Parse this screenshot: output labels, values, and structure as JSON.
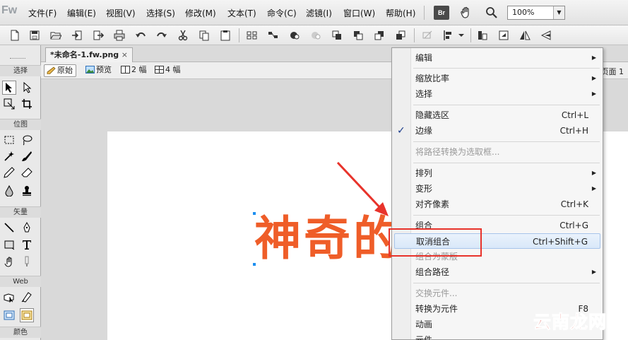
{
  "app": {
    "logo": "Fw"
  },
  "menubar": {
    "items": [
      "文件(F)",
      "编辑(E)",
      "视图(V)",
      "选择(S)",
      "修改(M)",
      "文本(T)",
      "命令(C)",
      "滤镜(I)",
      "窗口(W)",
      "帮助(H)"
    ],
    "bridge_button": "Br",
    "hand_icon": "hand-icon",
    "zoom_icon": "magnifier-icon",
    "zoom_value": "100%"
  },
  "toolbar": {
    "icons": [
      "new-file-icon",
      "save-icon",
      "open-icon",
      "import-icon",
      "export-icon",
      "print-icon",
      "undo-icon",
      "redo-icon",
      "cut-icon",
      "copy-icon",
      "paste-icon",
      "group-icon",
      "ungroup-icon",
      "join-icon",
      "split-icon",
      "bring-front-icon",
      "bring-forward-icon",
      "send-backward-icon",
      "send-back-icon",
      "align-icon",
      "distribute-icon",
      "rotate-icon",
      "flip-horizontal-icon",
      "flip-vertical-icon",
      "flip-icon"
    ]
  },
  "tools": {
    "sections": [
      "选择",
      "位图",
      "矢量",
      "Web",
      "颜色"
    ]
  },
  "document": {
    "tab_title": "*未命名-1.fw.png",
    "tab_close": "×",
    "views": [
      "原始",
      "预览",
      "2 幅",
      "4 幅"
    ],
    "page_label": "页面 1",
    "canvas_text": "神奇的"
  },
  "context_menu": {
    "items": [
      {
        "label": "编辑",
        "shortcut": "",
        "submenu": true,
        "disabled": false,
        "checked": false
      },
      {
        "label": "缩放比率",
        "shortcut": "",
        "submenu": true,
        "disabled": false,
        "checked": false
      },
      {
        "label": "选择",
        "shortcut": "",
        "submenu": true,
        "disabled": false,
        "checked": false
      },
      {
        "label": "隐藏选区",
        "shortcut": "Ctrl+L",
        "submenu": false,
        "disabled": false,
        "checked": false
      },
      {
        "label": "边缘",
        "shortcut": "Ctrl+H",
        "submenu": false,
        "disabled": false,
        "checked": true
      },
      {
        "label": "将路径转换为选取框...",
        "shortcut": "",
        "submenu": false,
        "disabled": true,
        "checked": false
      },
      {
        "label": "排列",
        "shortcut": "",
        "submenu": true,
        "disabled": false,
        "checked": false
      },
      {
        "label": "变形",
        "shortcut": "",
        "submenu": true,
        "disabled": false,
        "checked": false
      },
      {
        "label": "对齐像素",
        "shortcut": "Ctrl+K",
        "submenu": false,
        "disabled": false,
        "checked": false
      },
      {
        "label": "组合",
        "shortcut": "Ctrl+G",
        "submenu": false,
        "disabled": false,
        "checked": false
      },
      {
        "label": "取消组合",
        "shortcut": "Ctrl+Shift+G",
        "submenu": false,
        "disabled": false,
        "checked": false,
        "highlighted": true
      },
      {
        "label": "组合为蒙版",
        "shortcut": "",
        "submenu": false,
        "disabled": true,
        "checked": false
      },
      {
        "label": "组合路径",
        "shortcut": "",
        "submenu": true,
        "disabled": false,
        "checked": false
      },
      {
        "label": "交换元件...",
        "shortcut": "",
        "submenu": false,
        "disabled": true,
        "checked": false
      },
      {
        "label": "转换为元件",
        "shortcut": "F8",
        "submenu": false,
        "disabled": false,
        "checked": false
      },
      {
        "label": "动画",
        "shortcut": "",
        "submenu": false,
        "disabled": false,
        "checked": false
      },
      {
        "label": "元件",
        "shortcut": "",
        "submenu": false,
        "disabled": false,
        "checked": false
      }
    ],
    "check_mark": "✓",
    "submenu_arrow": "▶"
  },
  "watermark": "云南龙网",
  "colors": {
    "canvas_text": "#ef5d28",
    "annotation_red": "#e8332b",
    "highlight": "#d9e8f9"
  }
}
